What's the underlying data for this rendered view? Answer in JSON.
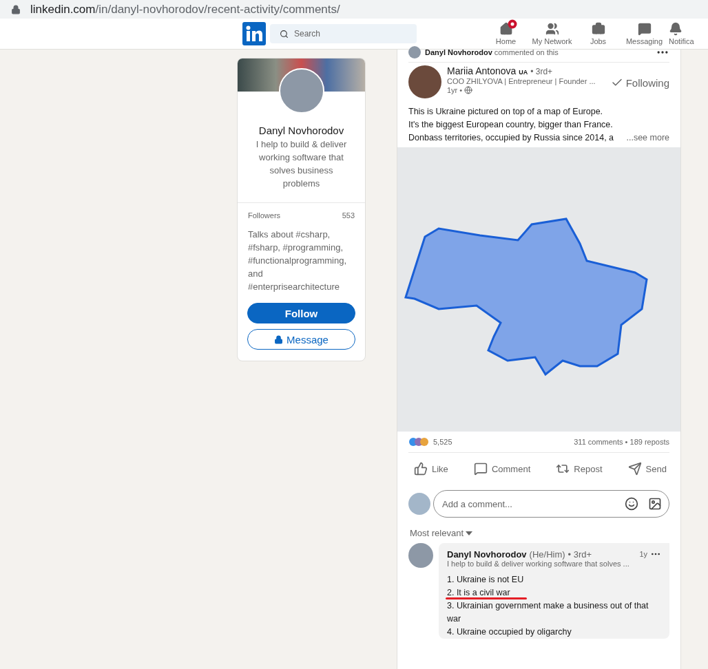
{
  "address_bar": {
    "domain": "linkedin.com",
    "path": "/in/danyl-novhorodov/recent-activity/comments/"
  },
  "header": {
    "search": {
      "placeholder": "Search"
    },
    "nav": [
      {
        "kind": "home",
        "label": "Home",
        "notification": true
      },
      {
        "kind": "network",
        "label": "My Network",
        "notification": false
      },
      {
        "kind": "jobs",
        "label": "Jobs",
        "notification": false
      },
      {
        "kind": "messaging",
        "label": "Messaging",
        "notification": false
      },
      {
        "kind": "notifications",
        "label": "Notifica",
        "notification": false
      }
    ]
  },
  "profile_card": {
    "name": "Danyl Novhorodov",
    "headline": "I help to build & deliver working software that solves business problems",
    "followers_label": "Followers",
    "followers_count": "553",
    "talks_about": "Talks about #csharp, #fsharp, #programming, #functionalprogramming, and #enterprisearchitecture",
    "buttons": [
      {
        "kind": "primary",
        "label": "Follow"
      },
      {
        "kind": "message",
        "label": "Message"
      }
    ]
  },
  "activity": {
    "actor": "Danyl Novhorodov",
    "action": "commented on this"
  },
  "post": {
    "author": "Mariia Antonova",
    "badge": "UA",
    "degree": "• 3rd+",
    "subtitle": "COO ZHILYOVA | Entrepreneur | Founder ...",
    "time": "1yr •",
    "follow_label": "Following",
    "text_lines": [
      "This is Ukraine pictured on top of a map of Europe.",
      "It's the biggest European country, bigger than France.",
      "Donbass territories, occupied by Russia since 2014, a"
    ],
    "see_more": "...see more",
    "reactions_count": "5,525",
    "stats": "311 comments • 189 reposts",
    "actions": [
      {
        "kind": "like",
        "label": "Like"
      },
      {
        "kind": "comment",
        "label": "Comment"
      },
      {
        "kind": "repost",
        "label": "Repost"
      },
      {
        "kind": "send",
        "label": "Send"
      }
    ]
  },
  "comment_box": {
    "placeholder": "Add a comment..."
  },
  "sort": {
    "label": "Most relevant"
  },
  "comment": {
    "author": "Danyl Novhorodov",
    "pronouns": "(He/Him)",
    "degree": "• 3rd+",
    "headline": "I help to build & deliver working software that solves ...",
    "time": "1y",
    "lines": [
      {
        "text": "1. Ukraine is not EU",
        "underlined": false
      },
      {
        "text": "2. It is a civil war",
        "underlined": true
      },
      {
        "text": "3. Ukrainian government make a business out of that war",
        "underlined": false
      },
      {
        "text": "4. Ukraine occupied by oligarchy",
        "underlined": false
      }
    ]
  }
}
